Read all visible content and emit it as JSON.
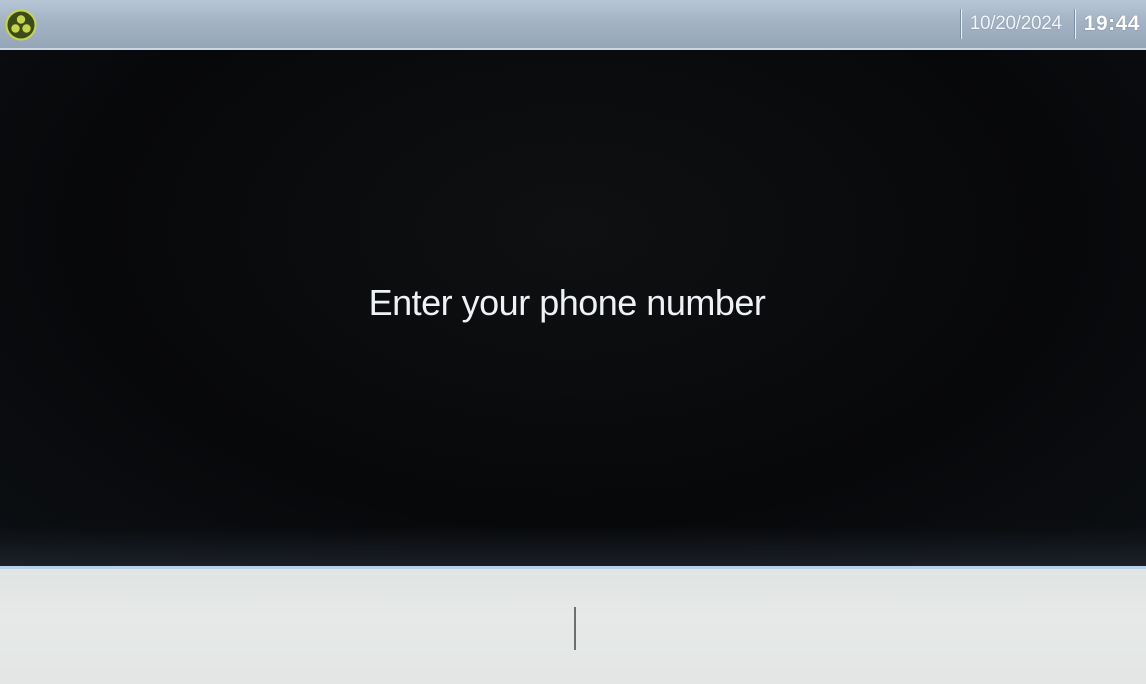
{
  "status_bar": {
    "logo_icon": "tri-circle-logo-icon",
    "date": "10/20/2024",
    "time": "19:44"
  },
  "main": {
    "prompt": "Enter your phone number"
  },
  "phone_input": {
    "value": ""
  },
  "colors": {
    "status_bar": "#a3b3c4",
    "background": "#07080a",
    "prompt_text": "#eef1f5",
    "input_background": "#e3e6e4",
    "input_top_border": "#b9d2ec",
    "logo_accent": "#c6d64a"
  }
}
